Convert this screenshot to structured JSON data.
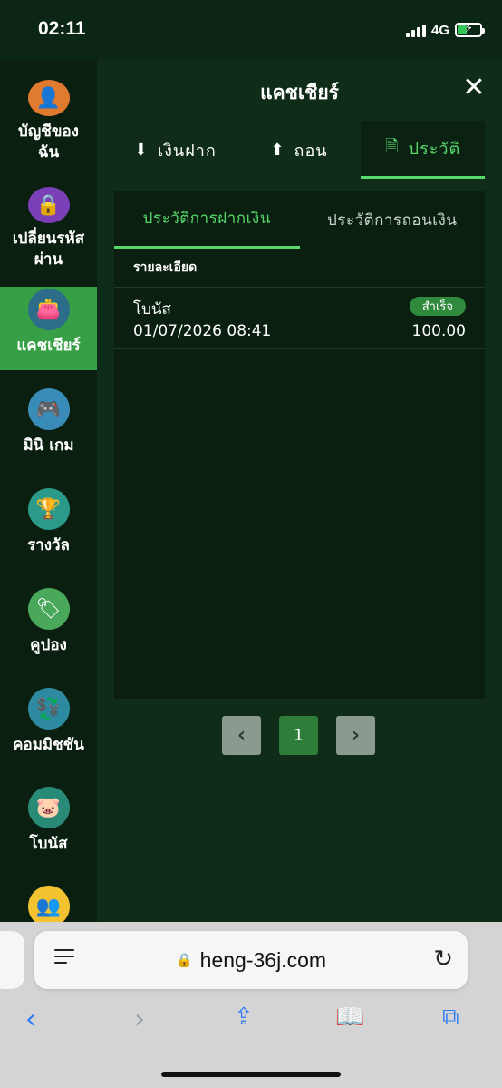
{
  "status": {
    "time": "02:11",
    "network": "4G"
  },
  "sidebar": {
    "items": [
      {
        "label": "บัญชีของฉัน",
        "icon": "user-avatar-icon",
        "color": "#e07a2f",
        "glyph": "👤"
      },
      {
        "label": "เปลี่ยนรหัสผ่าน",
        "icon": "lock-icon",
        "color": "#7b3fb8",
        "glyph": "🔒"
      },
      {
        "label": "แคชเชียร์",
        "icon": "wallet-icon",
        "color": "#2c6d8a",
        "glyph": "👛"
      },
      {
        "label": "มินิ เกม",
        "icon": "gamepad-icon",
        "color": "#3a8cb8",
        "glyph": "🎮"
      },
      {
        "label": "รางวัล",
        "icon": "trophy-icon",
        "color": "#2c9a8a",
        "glyph": "🏆"
      },
      {
        "label": "คูปอง",
        "icon": "coupon-tag-icon",
        "color": "#4aa85a",
        "glyph": "🏷"
      },
      {
        "label": "คอมมิชชัน",
        "icon": "commission-hand-icon",
        "color": "#2d8aa0",
        "glyph": "💱"
      },
      {
        "label": "โบนัส",
        "icon": "piggy-bank-icon",
        "color": "#2a8a78",
        "glyph": "🐷"
      },
      {
        "label": "",
        "icon": "network-people-icon",
        "color": "#f2c230",
        "glyph": "👥"
      }
    ],
    "active_index": 2
  },
  "cashier": {
    "title": "แคชเชียร์",
    "tabs": [
      {
        "label": "เงินฝาก",
        "icon": "deposit-icon",
        "glyph": "⬇"
      },
      {
        "label": "ถอน",
        "icon": "withdraw-icon",
        "glyph": "⬆"
      },
      {
        "label": "ประวัติ",
        "icon": "history-icon",
        "glyph": "🗎"
      }
    ],
    "active_tab": 2,
    "subtabs": [
      "ประวัติการฝากเงิน",
      "ประวัติการถอนเงิน"
    ],
    "active_subtab": 0,
    "detail_header": "รายละเอียด",
    "records": [
      {
        "type": "โบนัส",
        "status": "สำเร็จ",
        "datetime": "01/07/2026 08:41",
        "amount": "100.00"
      }
    ],
    "pagination": {
      "current": "1",
      "prev_icon": "chevron-left-icon",
      "next_icon": "chevron-right-icon"
    }
  },
  "browser": {
    "url": "heng-36j.com"
  },
  "colors": {
    "accent": "#57d86b",
    "active_sidebar": "#37a046",
    "success_badge": "#2f8a3d",
    "background": "#0f2c18"
  }
}
